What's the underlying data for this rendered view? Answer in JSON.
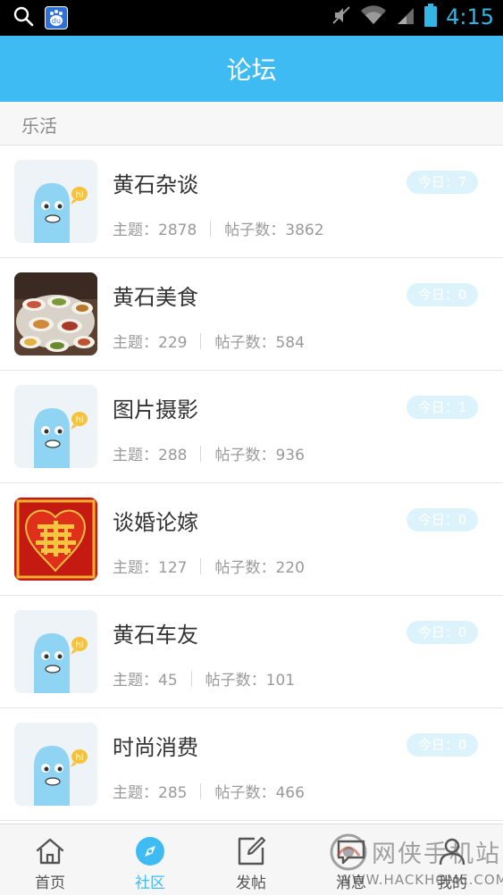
{
  "status_bar": {
    "time": "4:15",
    "icons": [
      "search-icon",
      "baidu-icon",
      "mute-icon",
      "wifi-icon",
      "signal-icon",
      "battery-icon"
    ],
    "baidu_text": "du",
    "time_color": "#33b5e5"
  },
  "header": {
    "title": "论坛",
    "color": "#3dbbf2"
  },
  "section": {
    "label": "乐活"
  },
  "forums": [
    {
      "name": "黄石杂谈",
      "topics": "主题：2878",
      "posts": "帖子数：3862",
      "today": "今日：7",
      "thumb": "mascot"
    },
    {
      "name": "黄石美食",
      "topics": "主题：229",
      "posts": "帖子数：584",
      "today": "今日：0",
      "thumb": "food-photo"
    },
    {
      "name": "图片摄影",
      "topics": "主题：288",
      "posts": "帖子数：936",
      "today": "今日：1",
      "thumb": "mascot"
    },
    {
      "name": "谈婚论嫁",
      "topics": "主题：127",
      "posts": "帖子数：220",
      "today": "今日：0",
      "thumb": "double-happiness"
    },
    {
      "name": "黄石车友",
      "topics": "主题：45",
      "posts": "帖子数：101",
      "today": "今日：0",
      "thumb": "mascot"
    },
    {
      "name": "时尚消费",
      "topics": "主题：285",
      "posts": "帖子数：466",
      "today": "今日：0",
      "thumb": "mascot"
    }
  ],
  "mascot_bubble_text": "hi",
  "bottom_nav": [
    {
      "label": "首页",
      "icon": "home-icon",
      "active": false
    },
    {
      "label": "社区",
      "icon": "compass-icon",
      "active": true
    },
    {
      "label": "发帖",
      "icon": "compose-icon",
      "active": false
    },
    {
      "label": "消息",
      "icon": "message-icon",
      "active": false
    },
    {
      "label": "我的",
      "icon": "profile-icon",
      "active": false
    }
  ],
  "watermark": {
    "cn": "网侠手机站",
    "en": "WWW.HACKHOME.COM"
  }
}
